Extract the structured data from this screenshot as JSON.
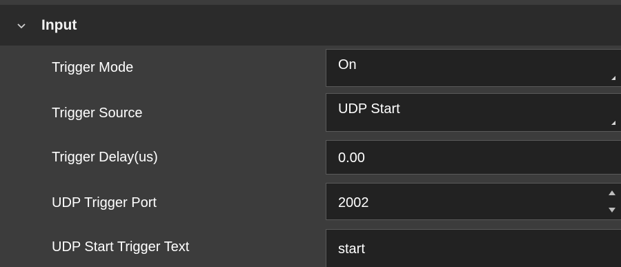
{
  "section": {
    "title": "Input",
    "icon": "chevron-down-icon"
  },
  "rows": [
    {
      "label": "Trigger Mode",
      "value": "On",
      "control": "combo"
    },
    {
      "label": "Trigger Source",
      "value": "UDP Start",
      "control": "combo"
    },
    {
      "label": "Trigger Delay(us)",
      "value": "0.00",
      "control": "text"
    },
    {
      "label": "UDP Trigger Port",
      "value": "2002",
      "control": "spinbox"
    },
    {
      "label": "UDP Start Trigger Text",
      "value": "start",
      "control": "text"
    }
  ],
  "colors": {
    "panel_bg": "#3c3c3c",
    "header_bg": "#2b2b2b",
    "field_bg": "#222222",
    "field_border": "#5a5a5a",
    "text": "#ffffff"
  }
}
